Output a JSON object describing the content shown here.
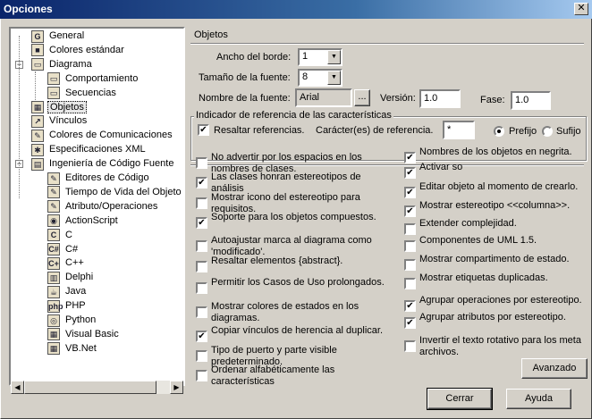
{
  "window": {
    "title": "Opciones",
    "close_glyph": "✕"
  },
  "tree": {
    "items": [
      {
        "label": "General",
        "icon": "G",
        "icon_name": "general-icon"
      },
      {
        "label": "Colores estándar",
        "icon": "■",
        "icon_name": "colors-icon"
      },
      {
        "label": "Diagrama",
        "icon": "▭",
        "icon_name": "diagram-icon"
      },
      {
        "label": "Comportamiento",
        "icon": "▭",
        "icon_name": "behavior-icon"
      },
      {
        "label": "Secuencias",
        "icon": "▭",
        "icon_name": "sequence-icon"
      },
      {
        "label": "Objetos",
        "icon": "▦",
        "icon_name": "objects-icon"
      },
      {
        "label": "Vínculos",
        "icon": "↗",
        "icon_name": "links-icon"
      },
      {
        "label": "Colores de Comunicaciones",
        "icon": "✎",
        "icon_name": "comm-colors-icon"
      },
      {
        "label": "Especificaciones XML",
        "icon": "✱",
        "icon_name": "xml-icon"
      },
      {
        "label": "Ingeniería de Código Fuente",
        "icon": "▤",
        "icon_name": "code-engineering-icon"
      },
      {
        "label": "Editores de Código",
        "icon": "✎",
        "icon_name": "code-editor-icon"
      },
      {
        "label": "Tiempo de Vida del Objeto",
        "icon": "✎",
        "icon_name": "object-lifetime-icon"
      },
      {
        "label": "Atributo/Operaciones",
        "icon": "✎",
        "icon_name": "attributes-icon"
      },
      {
        "label": "ActionScript",
        "icon": "◉",
        "icon_name": "actionscript-icon"
      },
      {
        "label": "C",
        "icon": "C",
        "icon_name": "c-icon"
      },
      {
        "label": "C#",
        "icon": "C#",
        "icon_name": "csharp-icon"
      },
      {
        "label": "C++",
        "icon": "C+",
        "icon_name": "cpp-icon"
      },
      {
        "label": "Delphi",
        "icon": "▥",
        "icon_name": "delphi-icon"
      },
      {
        "label": "Java",
        "icon": "☕",
        "icon_name": "java-icon"
      },
      {
        "label": "PHP",
        "icon": "php",
        "icon_name": "php-icon"
      },
      {
        "label": "Python",
        "icon": "◎",
        "icon_name": "python-icon"
      },
      {
        "label": "Visual Basic",
        "icon": "▦",
        "icon_name": "vb-icon"
      },
      {
        "label": "VB.Net",
        "icon": "▦",
        "icon_name": "vbnet-icon"
      }
    ]
  },
  "objetos": {
    "section_title": "Objetos",
    "border_width_label": "Ancho del borde:",
    "border_width_value": "1",
    "font_size_label": "Tamaño de la fuente:",
    "font_size_value": "8",
    "font_name_label": "Nombre de la fuente:",
    "font_name_value": "Arial",
    "browse_label": "...",
    "version_label": "Versión:",
    "version_value": "1.0",
    "phase_label": "Fase:",
    "phase_value": "1.0"
  },
  "feature_ref": {
    "group_title": "Indicador de referencia de las características",
    "highlight_label": "Resaltar referencias.",
    "highlight_checked": true,
    "chars_label": "Carácter(es) de referencia.",
    "chars_value": "*",
    "prefix_label": "Prefijo",
    "suffix_label": "Sufijo",
    "prefix_selected": true
  },
  "left_options": [
    {
      "label": "No advertir por los espacios en los nombres de clases.",
      "checked": false
    },
    {
      "label": "Las clases honran estereotipos de análisis",
      "checked": true
    },
    {
      "label": "Mostrar icono del estereotipo para requisitos.",
      "checked": false
    },
    {
      "label": "Soporte para los objetos compuestos.",
      "checked": true
    },
    {
      "label": "Autoajustar marca al diagrama como 'modificado'.",
      "checked": false
    },
    {
      "label": "Resaltar elementos {abstract}.",
      "checked": false
    },
    {
      "label": "Permitir los Casos de Uso prolongados.",
      "checked": false
    },
    {
      "label": "Mostrar colores de estados en los diagramas.",
      "checked": false
    },
    {
      "label": "Copiar vínculos de herencia al duplicar.",
      "checked": true
    },
    {
      "label": "Tipo de puerto y parte visible predeterminado.",
      "checked": false
    },
    {
      "label": "Ordenar alfabéticamente las características",
      "checked": false
    }
  ],
  "right_options": [
    {
      "label": "Nombres de los objetos en negrita.",
      "checked": true
    },
    {
      "label": "Activar so",
      "checked": true
    },
    {
      "label": "Editar objeto al momento de crearlo.",
      "checked": true
    },
    {
      "label": "Mostrar estereotipo <<columna>>.",
      "checked": true
    },
    {
      "label": "Extender complejidad.",
      "checked": false
    },
    {
      "label": "Componentes de UML 1.5.",
      "checked": false
    },
    {
      "label": "Mostrar compartimento de estado.",
      "checked": false
    },
    {
      "label": "Mostrar etiquetas duplicadas.",
      "checked": false
    },
    {
      "label": "Agrupar operaciones por estereotipo.",
      "checked": true
    },
    {
      "label": "Agrupar atributos por estereotipo.",
      "checked": true
    },
    {
      "label": "Invertir el texto rotativo para los meta archivos.",
      "checked": false
    }
  ],
  "buttons": {
    "advanced": "Avanzado",
    "close": "Cerrar",
    "help": "Ayuda"
  },
  "glyphs": {
    "check": "✔",
    "down": "▼",
    "left": "◀",
    "right": "▶",
    "plus": "+",
    "minus": "−"
  }
}
